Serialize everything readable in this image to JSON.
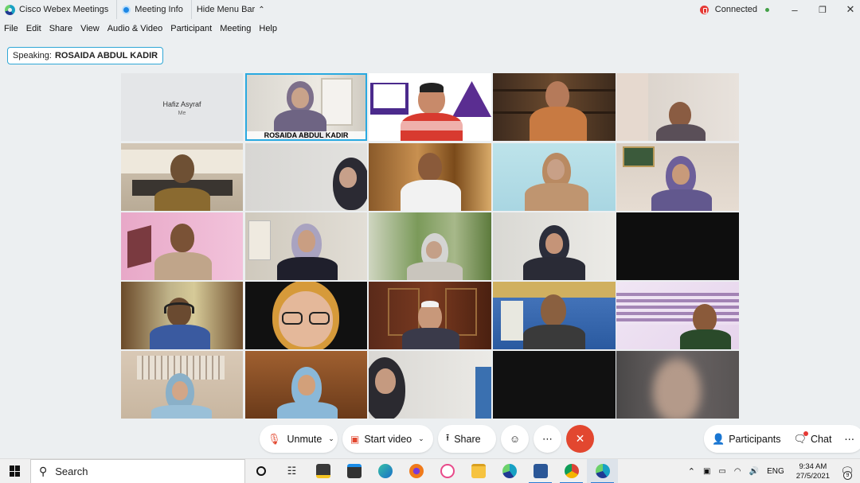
{
  "titlebar": {
    "app_name": "Cisco Webex Meetings",
    "meeting_info": "Meeting Info",
    "hide_menu": "Hide Menu Bar",
    "status": "Connected"
  },
  "menu": [
    "File",
    "Edit",
    "Share",
    "View",
    "Audio & Video",
    "Participant",
    "Meeting",
    "Help"
  ],
  "speaking": {
    "label": "Speaking:",
    "name": "ROSAIDA ABDUL KADIR"
  },
  "grid": {
    "self_name": "Hafiz Asyraf",
    "self_sub": "Me",
    "active_speaker_label": "ROSAIDA ABDUL KADIR"
  },
  "controls": {
    "unmute": "Unmute",
    "start_video": "Start video",
    "share": "Share",
    "participants": "Participants",
    "chat": "Chat"
  },
  "taskbar": {
    "search": "Search",
    "lang": "ENG",
    "time": "9:34 AM",
    "date": "27/5/2021",
    "notif_count": "9"
  },
  "colors": {
    "active_border": "#29a9e0",
    "leave_button": "#e2472f",
    "status_connected": "#43a047"
  }
}
